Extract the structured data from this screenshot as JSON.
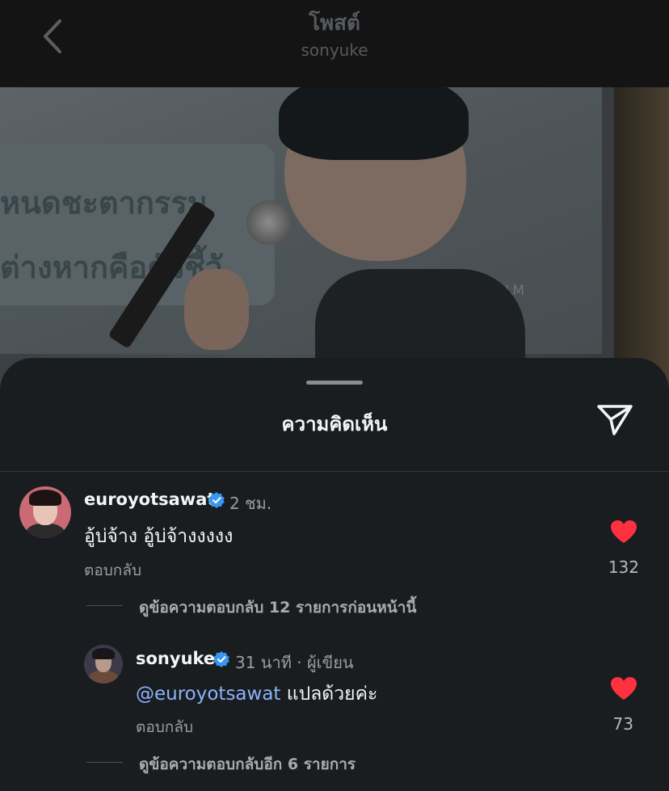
{
  "header": {
    "title": "โพสต์",
    "subtitle": "sonyuke"
  },
  "photo": {
    "slide_line_1": "หนดชะตากรรม",
    "slide_line_2": "ต่างหากคือตัวชี้วั",
    "slide_brand": "NotebookLM"
  },
  "comments_sheet": {
    "title": "ความคิดเห็น"
  },
  "comments": [
    {
      "username": "euroyotsawat",
      "verified": true,
      "time": "2 ชม.",
      "text": "อู้บ่จ้าง อู้บ่จ้างงงงง",
      "reply_label": "ตอบกลับ",
      "likes": "132",
      "view_replies": "ดูข้อความตอบกลับ 12 รายการก่อนหน้านี้"
    },
    {
      "username": "sonyuke",
      "verified": true,
      "time": "31 นาที · ผู้เขียน",
      "mention": "@euroyotsawat",
      "text": " แปลด้วยค่ะ",
      "reply_label": "ตอบกลับ",
      "likes": "73",
      "view_replies": "ดูข้อความตอบกลับอีก 6 รายการ"
    }
  ],
  "colors": {
    "mention": "#8ab4f8",
    "heart": "#ff3040",
    "verified": "#3897f0"
  }
}
